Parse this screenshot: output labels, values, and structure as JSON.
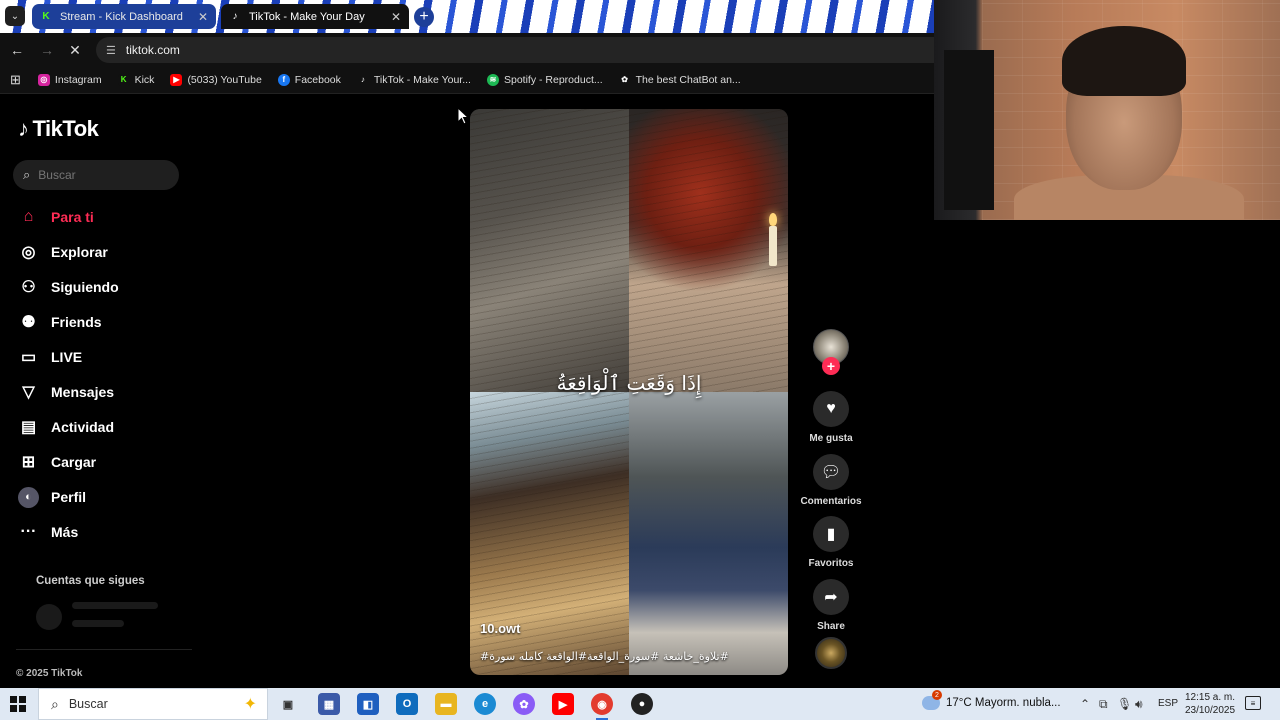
{
  "browser": {
    "tabs": [
      {
        "label": "Stream - Kick Dashboard",
        "icon": "kick-icon",
        "active": false
      },
      {
        "label": "TikTok - Make Your Day",
        "icon": "tiktok-icon",
        "active": true
      }
    ],
    "url": "tiktok.com",
    "bookmarks": [
      {
        "label": "Instagram",
        "icon": "instagram-icon",
        "color": "#d6249f"
      },
      {
        "label": "Kick",
        "icon": "kick-icon",
        "color": "#53fc18"
      },
      {
        "label": "(5033) YouTube",
        "icon": "youtube-icon",
        "color": "#ff0000"
      },
      {
        "label": "Facebook",
        "icon": "facebook-icon",
        "color": "#1877f2"
      },
      {
        "label": "TikTok - Make Your...",
        "icon": "tiktok-icon",
        "color": "#000000"
      },
      {
        "label": "Spotify - Reproduct...",
        "icon": "spotify-icon",
        "color": "#1db954"
      },
      {
        "label": "The best ChatBot an...",
        "icon": "chatbot-icon",
        "color": "#000000"
      }
    ]
  },
  "tiktok": {
    "logo": "TikTok",
    "search_placeholder": "Buscar",
    "nav": [
      {
        "label": "Para ti",
        "icon": "home-icon",
        "active": true
      },
      {
        "label": "Explorar",
        "icon": "compass-icon",
        "active": false
      },
      {
        "label": "Siguiendo",
        "icon": "following-icon",
        "active": false
      },
      {
        "label": "Friends",
        "icon": "friends-icon",
        "active": false
      },
      {
        "label": "LIVE",
        "icon": "live-icon",
        "active": false
      },
      {
        "label": "Mensajes",
        "icon": "messages-icon",
        "active": false
      },
      {
        "label": "Actividad",
        "icon": "activity-icon",
        "active": false
      },
      {
        "label": "Cargar",
        "icon": "upload-icon",
        "active": false
      },
      {
        "label": "Perfil",
        "icon": "profile-avatar",
        "active": false
      },
      {
        "label": "Más",
        "icon": "more-icon",
        "active": false
      }
    ],
    "following_title": "Cuentas que sigues",
    "copyright": "© 2025 TikTok",
    "video": {
      "overlay_text": "إِذَا وَقَعَتِ ٱلْوَاقِعَةُ",
      "author": "10.owt",
      "description": "#تلاوة_خاشعة #سورة_الواقعة#الواقعة كامله سورة#"
    },
    "actions": [
      {
        "label": "Me gusta",
        "icon": "heart-icon"
      },
      {
        "label": "Comentarios",
        "icon": "comment-icon"
      },
      {
        "label": "Favoritos",
        "icon": "bookmark-icon"
      },
      {
        "label": "Share",
        "icon": "share-icon"
      }
    ],
    "accent_color": "#fe2c55"
  },
  "taskbar": {
    "search_placeholder": "Buscar",
    "weather": "17°C  Mayorm. nubla...",
    "weather_badge": "2",
    "language": "ESP",
    "time": "12:15 a. m.",
    "date": "23/10/2025"
  }
}
